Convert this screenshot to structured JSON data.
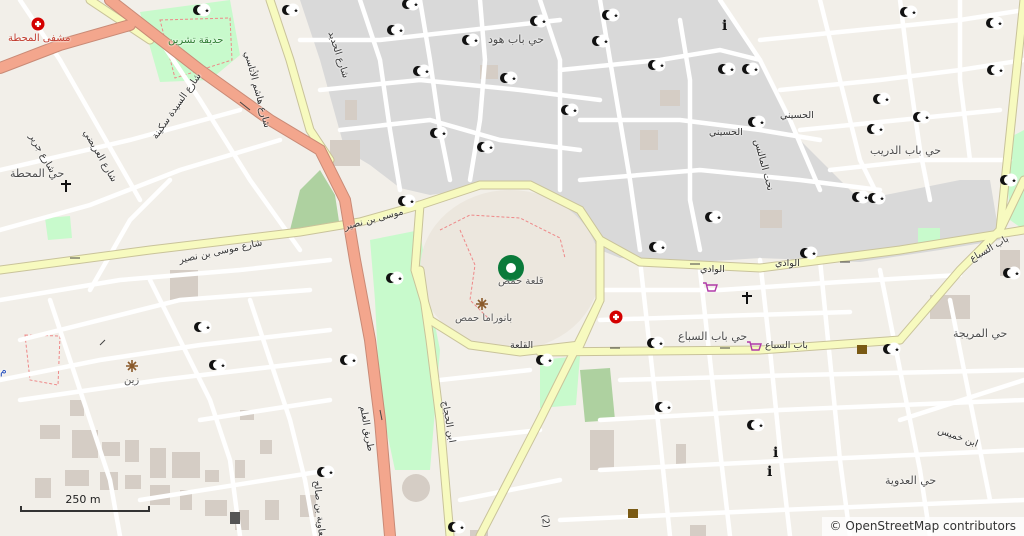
{
  "map": {
    "scale_label": "250 m",
    "attribution_prefix": "©",
    "attribution_link": "OpenStreetMap contributors",
    "colors": {
      "background": "#f2efe9",
      "residential_dense": "#d9d9d9",
      "park": "#c8facc",
      "green": "#aed1a0",
      "trunk_road": "#f3a68d",
      "secondary_road": "#f7fabf",
      "minor_road": "#ffffff",
      "building": "#d5cdc5",
      "mosque_icon": "#000000",
      "hospital_icon": "#d40000",
      "landmark_icon": "#0a7a3a"
    }
  },
  "labels": {
    "hospital": "مشفى المحطة",
    "tishreen_garden": "حديقة تشرين",
    "street_aleem": "شارع هاشم الأتاسي",
    "street_hadid": "شارع الحديد",
    "hay_bab_hud": "حي باب هود",
    "street_aridi": "شارع العريضي",
    "street_jarir": "شارع جرير",
    "street_sakina": "شارع السيدة سكينة",
    "hay_mahatta": "حي المحطة",
    "musa_top": "موسى بن نصير",
    "musa_street": "شارع موسى بن نصير",
    "citadel": "قلعة حمص",
    "panorama": "بانوراما حمص",
    "wadi_1": "الوادي",
    "wadi_2": "الوادي",
    "hussaini_1": "الحسيني",
    "hussaini_2": "الحسيني",
    "nahr_malanis": "نحت المالنس",
    "hay_bab_dreib": "حي باب الدريب",
    "bab_siba_road": "باب السباع",
    "bab_siba_top": "باب السباع",
    "hay_bab_siba": "حي باب السباع",
    "hay_muraija": "حي المريجة",
    "qalaa_street": "القلعة",
    "ibn_hajjaj": "ابن الحجاج",
    "tariq_alam": "طريق العلم",
    "muawiya": "معاوية بن صالح",
    "ibn_khamis": "ابن خميس",
    "hay_adawiya": "حي العدوية",
    "zein": "زين",
    "two_paren": "(2)",
    "edge_letter": "م"
  }
}
